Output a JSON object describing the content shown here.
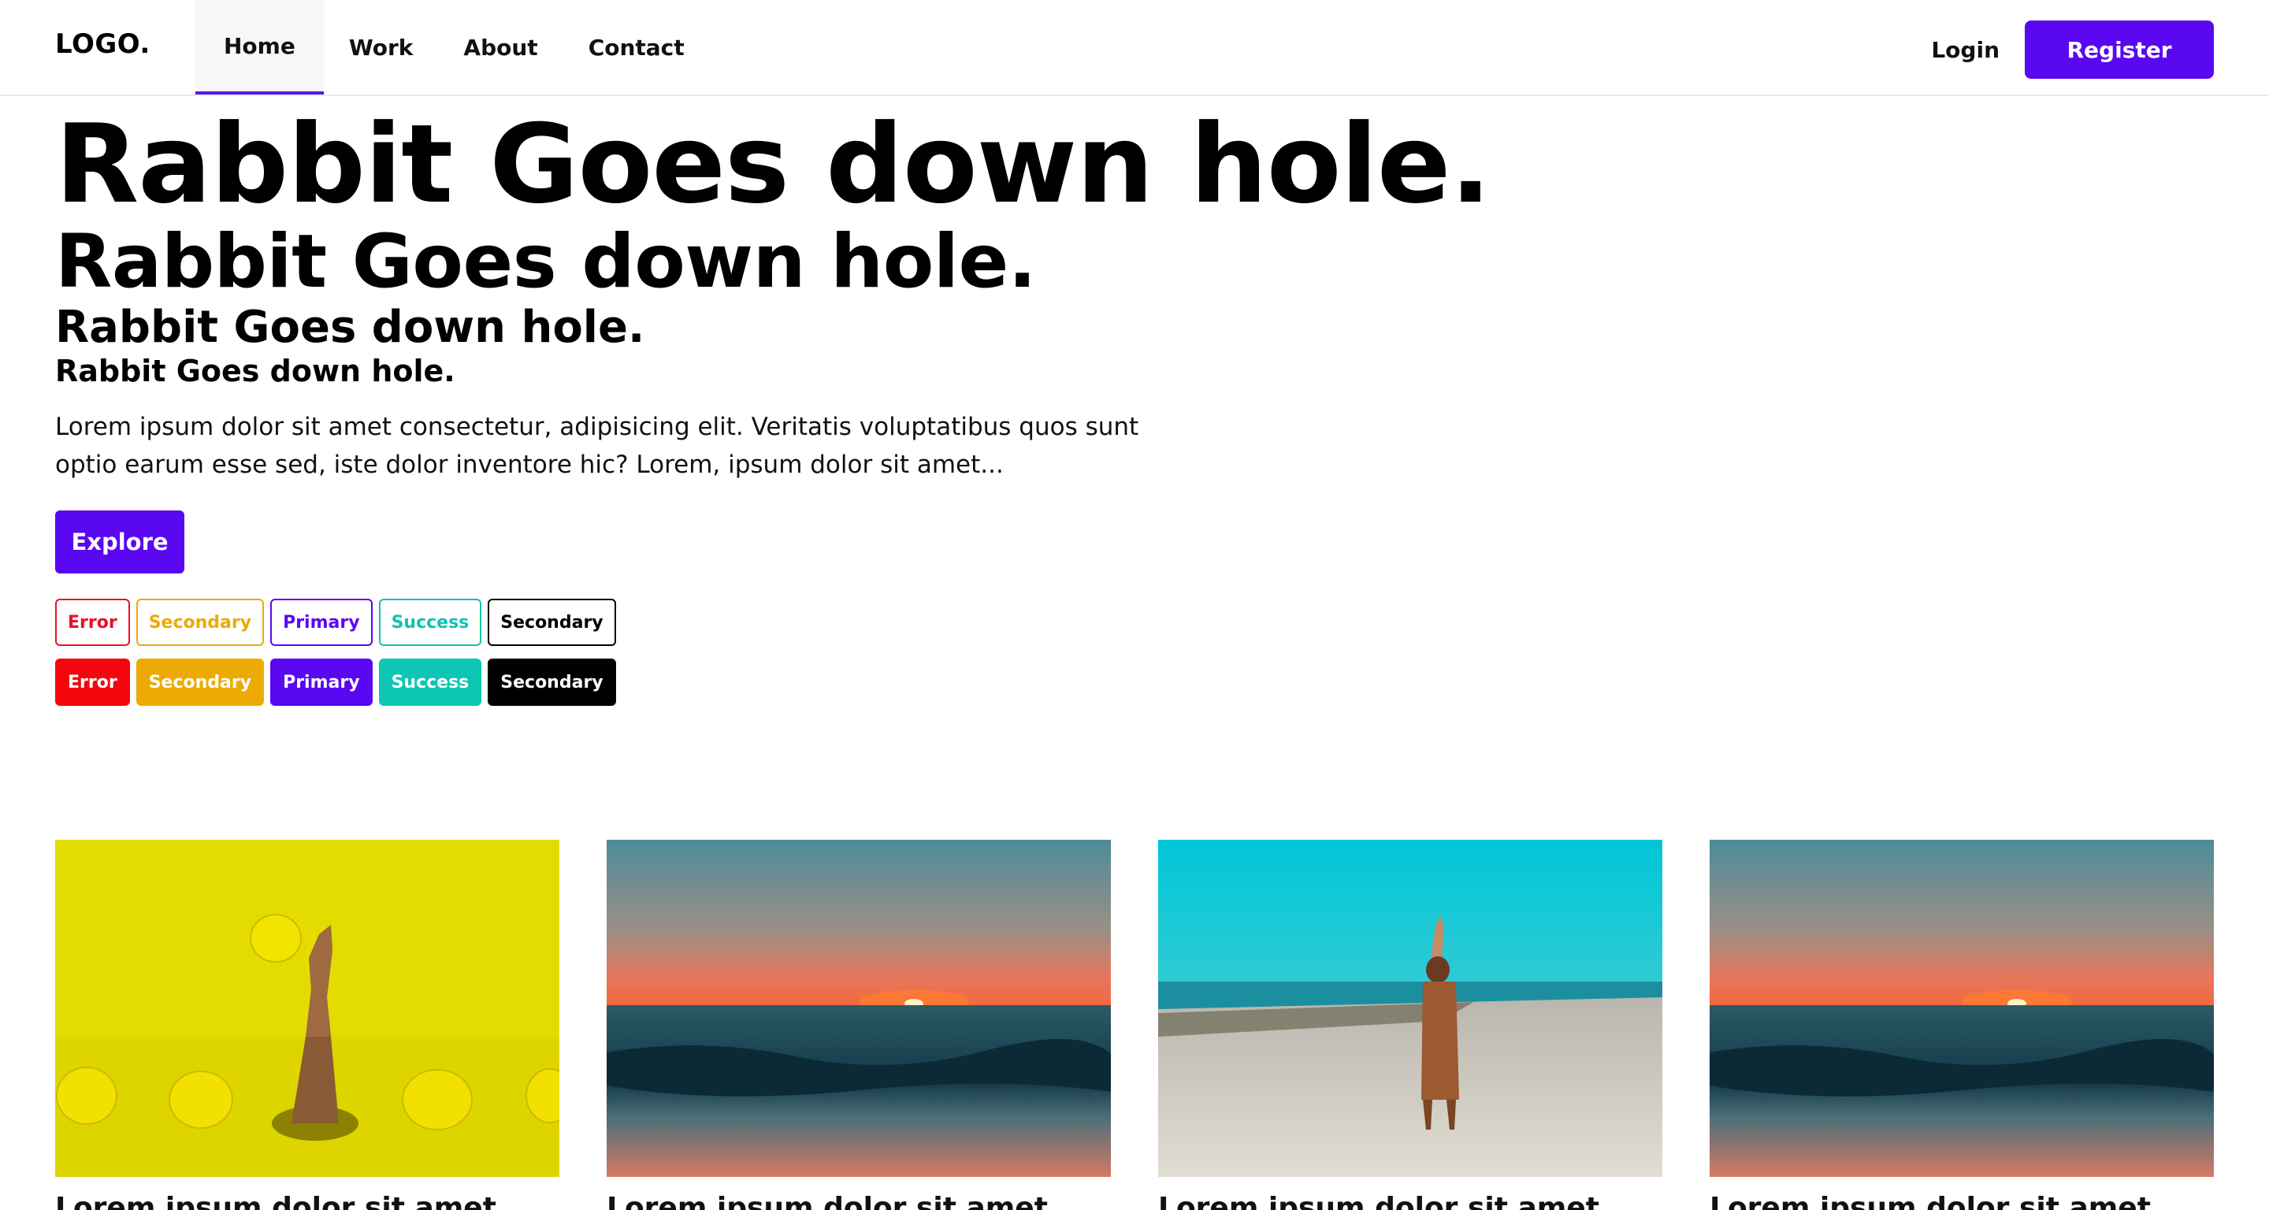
{
  "nav": {
    "logo": "LOGO.",
    "links": [
      "Home",
      "Work",
      "About",
      "Contact"
    ],
    "active": "Home",
    "login": "Login",
    "register": "Register"
  },
  "hero": {
    "h1": "Rabbit Goes down hole.",
    "h2": "Rabbit Goes down hole.",
    "h3": "Rabbit Goes down hole.",
    "h4": "Rabbit Goes down hole.",
    "description": "Lorem ipsum dolor sit amet consectetur, adipisicing elit. Veritatis voluptatibus quos sunt optio earum esse sed, iste dolor inventore hic? Lorem, ipsum dolor sit amet...",
    "explore_button": "Explore"
  },
  "badges": {
    "outlined": [
      "Error",
      "Secondary",
      "Primary",
      "Success",
      "Secondary"
    ],
    "filled": [
      "Error",
      "Secondary",
      "Primary",
      "Success",
      "Secondary"
    ]
  },
  "cards": [
    {
      "image": "lemon-hand-image",
      "title": "Lorem ipsum dolor sit amet"
    },
    {
      "image": "sunset-sea-image",
      "title": "Lorem ipsum dolor sit amet"
    },
    {
      "image": "beach-woman-image",
      "title": "Lorem ipsum dolor sit amet"
    },
    {
      "image": "sunset-sea-image",
      "title": "Lorem ipsum dolor sit amet"
    }
  ],
  "colors": {
    "primary": "#5a07f2",
    "error": "#f5050e",
    "warning": "#eeaa04",
    "success": "#0dc6b3",
    "dark": "#000000"
  }
}
